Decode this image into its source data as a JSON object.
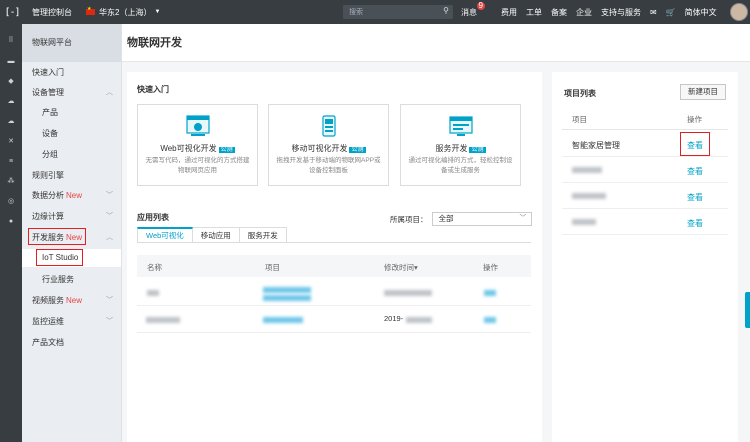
{
  "topbar": {
    "logo": "[-]",
    "console": "管理控制台",
    "region": "华东2（上海）",
    "search_placeholder": "搜索",
    "nav": {
      "messages": "消息",
      "messages_badge": "9",
      "billing": "费用",
      "tickets": "工单",
      "icp": "备案",
      "enterprise": "企业",
      "support": "支持与服务",
      "language": "简体中文"
    }
  },
  "sidebar": {
    "title": "物联网平台",
    "items": {
      "quickstart": "快速入门",
      "device_mgmt": "设备管理",
      "product": "产品",
      "device": "设备",
      "group": "分组",
      "rule_engine": "规则引擎",
      "data_analysis": "数据分析",
      "edge_compute": "边缘计算",
      "dev_service": "开发服务",
      "iot_studio": "IoT Studio",
      "industry_service": "行业服务",
      "video_service": "视频服务",
      "monitor_ops": "监控运维",
      "product_docs": "产品文档"
    },
    "new_tag": "New"
  },
  "page": {
    "title": "物联网开发"
  },
  "quick_entry": {
    "label": "快速入门",
    "cards": [
      {
        "title": "Web可视化开发",
        "tag": "公测",
        "desc": "无需写代码，通过可视化的方式搭建物联网页应用"
      },
      {
        "title": "移动可视化开发",
        "tag": "公测",
        "desc": "拖拽开发基于移动端的物联网APP或设备控制面板"
      },
      {
        "title": "服务开发",
        "tag": "公测",
        "desc": "通过可视化编排的方式，轻松控制设备或生成服务"
      }
    ]
  },
  "app_list": {
    "label": "应用列表",
    "tabs": [
      "Web可视化",
      "移动应用",
      "服务开发"
    ],
    "project_filter_label": "所属项目：",
    "project_filter_value": "全部",
    "columns": [
      "名称",
      "项目",
      "修改时间",
      "操作"
    ],
    "sort_indicator": "▾",
    "rows": [
      {
        "time_prefix": ""
      },
      {
        "time_prefix": "2019-"
      }
    ]
  },
  "project_list": {
    "label": "项目列表",
    "new_button": "新建项目",
    "columns": [
      "项目",
      "操作"
    ],
    "rows": [
      {
        "name": "智能家居管理",
        "action": "查看"
      },
      {
        "name": "",
        "action": "查看"
      },
      {
        "name": "",
        "action": "查看"
      },
      {
        "name": "",
        "action": "查看"
      }
    ]
  },
  "colors": {
    "topbar_bg": "#373d41",
    "accent": "#00a2ca",
    "highlight": "#e02020",
    "new_tag": "#e54545"
  }
}
